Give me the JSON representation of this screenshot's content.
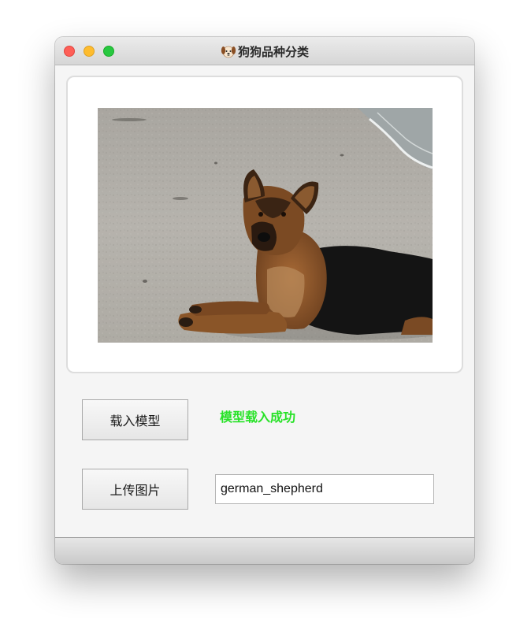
{
  "window": {
    "title": "狗狗品种分类",
    "title_icon": "dog-face-icon"
  },
  "image_panel": {
    "image": "german-shepherd-dog-on-beach-photo"
  },
  "controls": {
    "load_model_label": "载入模型",
    "upload_image_label": "上传图片",
    "status_text": "模型载入成功",
    "prediction_value": "german_shepherd"
  },
  "colors": {
    "status": "#27e227",
    "close": "#fe5f57",
    "minimize": "#febc2e",
    "maximize": "#28c840"
  }
}
